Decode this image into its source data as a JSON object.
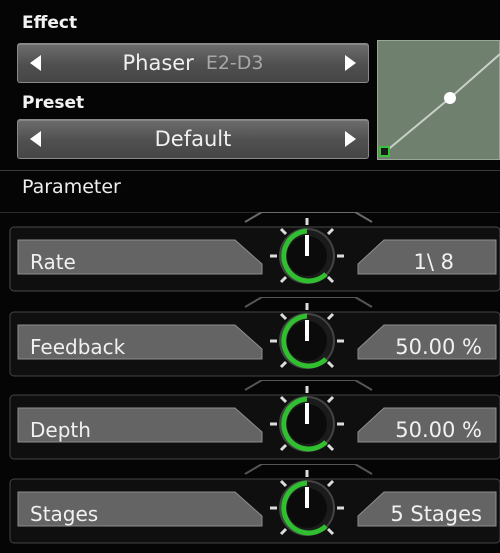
{
  "effect": {
    "label": "Effect",
    "name": "Phaser",
    "variant": "E2-D3"
  },
  "preset": {
    "label": "Preset",
    "name": "Default"
  },
  "parameter_section": {
    "title": "Parameter"
  },
  "parameters": [
    {
      "label": "Rate",
      "value": "1\\ 8"
    },
    {
      "label": "Feedback",
      "value": "50.00 %"
    },
    {
      "label": "Depth",
      "value": "50.00 %"
    },
    {
      "label": "Stages",
      "value": "5 Stages"
    }
  ],
  "colors": {
    "knob_arc": "#2fbf2f",
    "graph_bg": "#6f806f",
    "graph_handle": "#39c239",
    "panel": "#5a5a5a"
  },
  "icons": {
    "prev": "triangle-left-icon",
    "next": "triangle-right-icon"
  }
}
